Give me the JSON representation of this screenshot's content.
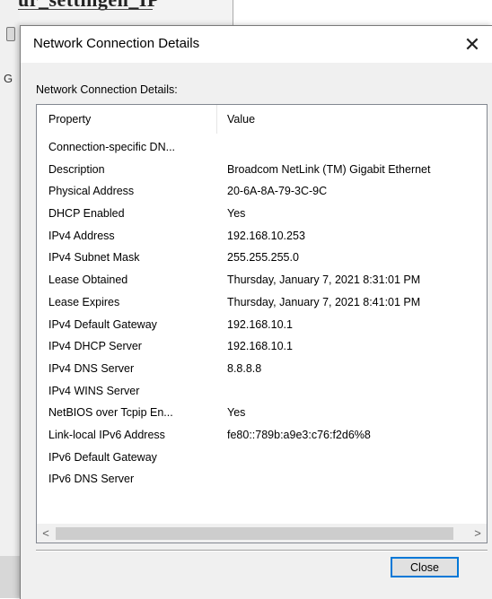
{
  "background": {
    "title_fragment": "ur_settingen_IP",
    "side_letter": "G"
  },
  "dialog": {
    "title": "Network Connection Details",
    "close_icon": "close-icon",
    "group_label": "Network Connection Details:",
    "columns": {
      "property": "Property",
      "value": "Value"
    },
    "rows": [
      {
        "property": "Connection-specific DN...",
        "value": ""
      },
      {
        "property": "Description",
        "value": "Broadcom NetLink (TM) Gigabit Ethernet"
      },
      {
        "property": "Physical Address",
        "value": "20-6A-8A-79-3C-9C"
      },
      {
        "property": "DHCP Enabled",
        "value": "Yes"
      },
      {
        "property": "IPv4 Address",
        "value": "192.168.10.253"
      },
      {
        "property": "IPv4 Subnet Mask",
        "value": "255.255.255.0"
      },
      {
        "property": "Lease Obtained",
        "value": "Thursday, January 7, 2021 8:31:01 PM"
      },
      {
        "property": "Lease Expires",
        "value": "Thursday, January 7, 2021 8:41:01 PM"
      },
      {
        "property": "IPv4 Default Gateway",
        "value": "192.168.10.1"
      },
      {
        "property": "IPv4 DHCP Server",
        "value": "192.168.10.1"
      },
      {
        "property": "IPv4 DNS Server",
        "value": "8.8.8.8"
      },
      {
        "property": "IPv4 WINS Server",
        "value": ""
      },
      {
        "property": "NetBIOS over Tcpip En...",
        "value": "Yes"
      },
      {
        "property": "Link-local IPv6 Address",
        "value": "fe80::789b:a9e3:c76:f2d6%8"
      },
      {
        "property": "IPv6 Default Gateway",
        "value": ""
      },
      {
        "property": "IPv6 DNS Server",
        "value": ""
      }
    ],
    "scrollbar": {
      "left_icon": "chevron-left-icon",
      "right_icon": "chevron-right-icon"
    },
    "close_button_label": "Close",
    "colors": {
      "accent": "#0078d7",
      "dialog_bg": "#f0f0f0",
      "list_bg": "#ffffff"
    }
  }
}
